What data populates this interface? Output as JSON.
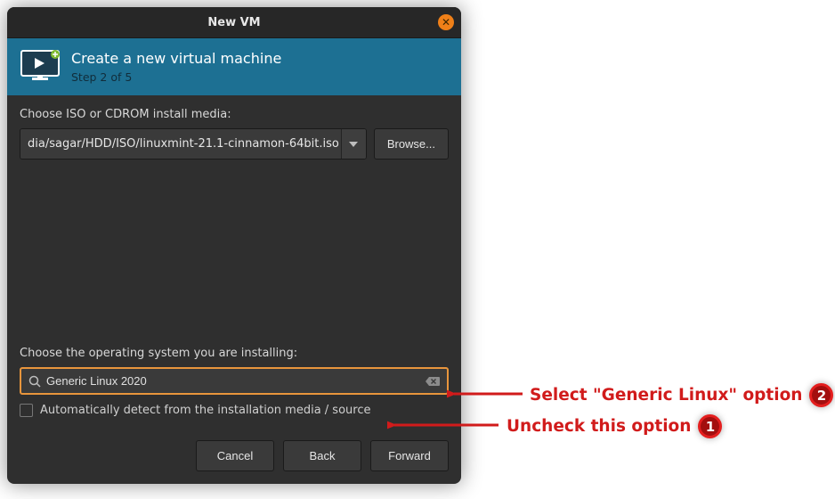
{
  "window": {
    "title": "New VM"
  },
  "banner": {
    "title": "Create a new virtual machine",
    "subtitle": "Step 2 of 5"
  },
  "media": {
    "label": "Choose ISO or CDROM install media:",
    "value": "dia/sagar/HDD/ISO/linuxmint-21.1-cinnamon-64bit.iso",
    "browse": "Browse..."
  },
  "os": {
    "label": "Choose the operating system you are installing:",
    "search_value": "Generic Linux 2020",
    "autodetect_label": "Automatically detect from the installation media / source",
    "autodetect_checked": false
  },
  "footer": {
    "cancel": "Cancel",
    "back": "Back",
    "forward": "Forward"
  },
  "annotations": {
    "a1_text": "Uncheck this option",
    "a1_num": "1",
    "a2_text": "Select \"Generic Linux\" option",
    "a2_num": "2"
  }
}
